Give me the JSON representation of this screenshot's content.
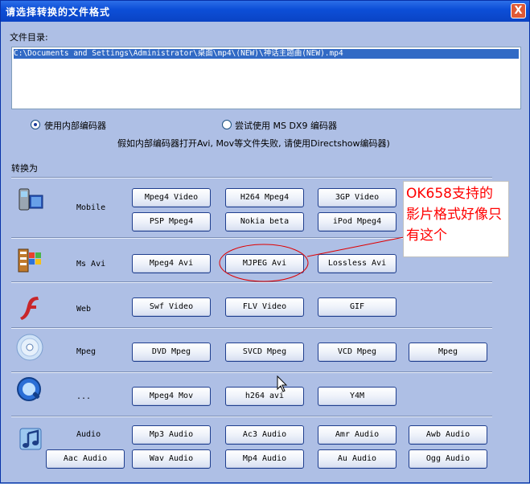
{
  "window": {
    "title": "请选择转换的文件格式",
    "close_glyph": "X"
  },
  "file_dir": {
    "label": "文件目录:",
    "selected_path": "C:\\Documents and Settings\\Administrator\\桌面\\mp4\\(NEW)\\神话主题曲(NEW).mp4"
  },
  "encoder": {
    "option_internal": "使用内部编码器",
    "option_dx9": "尝试使用 MS DX9 编码器",
    "hint": "假如内部编码器打开Avi, Mov等文件失败, 请使用Directshow编码器)",
    "selected": "internal"
  },
  "convert_label": "转换为",
  "categories": [
    {
      "name": "Mobile",
      "icon": "mobile-phone-icon",
      "buttons": [
        "Mpeg4 Video",
        "H264 Mpeg4",
        "3GP Video",
        "PSP Mpeg4",
        "Nokia beta",
        "iPod Mpeg4"
      ]
    },
    {
      "name": "Ms Avi",
      "icon": "windows-avi-icon",
      "buttons": [
        "Mpeg4 Avi",
        "MJPEG Avi",
        "Lossless Avi"
      ]
    },
    {
      "name": "Web",
      "icon": "flash-icon",
      "buttons": [
        "Swf Video",
        "FLV Video",
        "GIF"
      ]
    },
    {
      "name": "Mpeg",
      "icon": "disc-icon",
      "buttons": [
        "DVD Mpeg",
        "SVCD Mpeg",
        "VCD Mpeg",
        "Mpeg"
      ]
    },
    {
      "name": "...",
      "icon": "quicktime-icon",
      "buttons": [
        "Mpeg4 Mov",
        "h264 avi",
        "Y4M"
      ]
    },
    {
      "name": "Audio",
      "icon": "music-note-icon",
      "buttons": [
        "Mp3 Audio",
        "Ac3 Audio",
        "Amr Audio",
        "Awb Audio",
        "Aac Audio",
        "Wav Audio",
        "Mp4 Audio",
        "Au Audio",
        "Ogg Audio"
      ]
    }
  ],
  "annotation": {
    "text": "OK658支持的影片格式好像只有这个",
    "color": "#ff0000"
  },
  "colors": {
    "title_bar": "#0d4fd8",
    "dialog_bg": "#aebfe5",
    "highlight": "#316ac5",
    "annotation_red": "#ff0000"
  }
}
